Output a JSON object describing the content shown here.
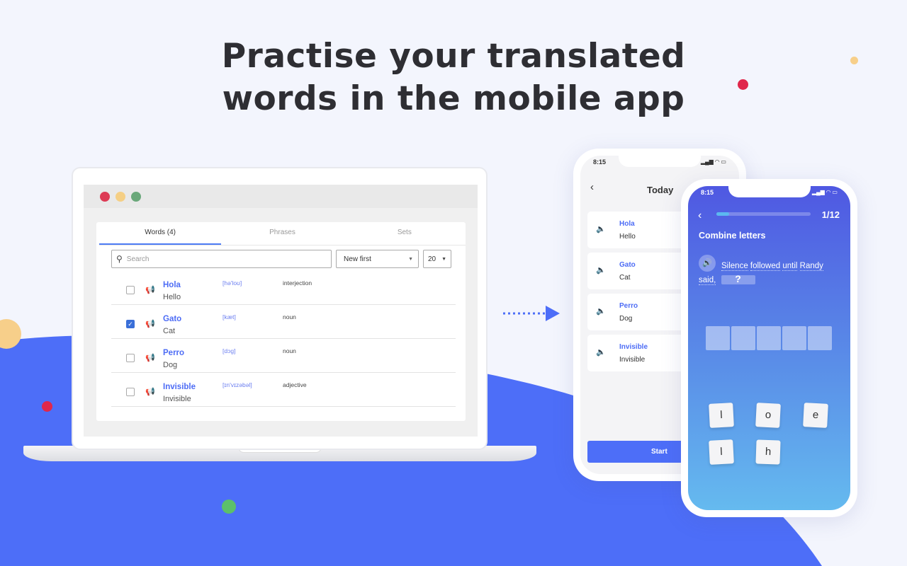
{
  "headline": {
    "line1": "Practise your translated",
    "line2": "words in the mobile app"
  },
  "colors": {
    "background": "#f3f5fd",
    "wave": "#4d6ef8",
    "accent": "#4d6cf5",
    "dot_red": "#e0274b",
    "dot_yellow": "#f7cf8a",
    "dot_green": "#5cc06a"
  },
  "laptop": {
    "window_controls": [
      "close",
      "minimize",
      "maximize"
    ],
    "tabs": [
      {
        "label": "Words (4)",
        "active": true
      },
      {
        "label": "Phrases"
      },
      {
        "label": "Sets"
      }
    ],
    "search": {
      "placeholder": "Search",
      "icon": "search-icon"
    },
    "sort": {
      "value": "New first"
    },
    "page_size": {
      "value": "20"
    },
    "words": [
      {
        "word": "Hola",
        "translation": "Hello",
        "phonetic": "[hə'loʊ]",
        "pos": "interjection",
        "checked": false
      },
      {
        "word": "Gato",
        "translation": "Cat",
        "phonetic": "[kæt]",
        "pos": "noun",
        "checked": true
      },
      {
        "word": "Perro",
        "translation": "Dog",
        "phonetic": "[dɔg]",
        "pos": "noun",
        "checked": false
      },
      {
        "word": "Invisible",
        "translation": "Invisible",
        "phonetic": "[ɪn'vɪzəbəl]",
        "pos": "adjective",
        "checked": false
      }
    ]
  },
  "phone1": {
    "time": "8:15",
    "title": "Today",
    "items": [
      {
        "word": "Hola",
        "translation": "Hello"
      },
      {
        "word": "Gato",
        "translation": "Cat"
      },
      {
        "word": "Perro",
        "translation": "Dog"
      },
      {
        "word": "Invisible",
        "translation": "Invisible"
      }
    ],
    "start_label": "Start"
  },
  "phone2": {
    "time": "8:15",
    "progress_label": "1/12",
    "progress": 0.083,
    "title": "Combine letters",
    "sentence": {
      "w1": "Silence",
      "w2": "followed",
      "w3": "until",
      "w4": "Randy",
      "w5": "said,",
      "blank": "?"
    },
    "slots": 5,
    "letters": [
      "l",
      "o",
      "e",
      "l",
      "h"
    ]
  }
}
